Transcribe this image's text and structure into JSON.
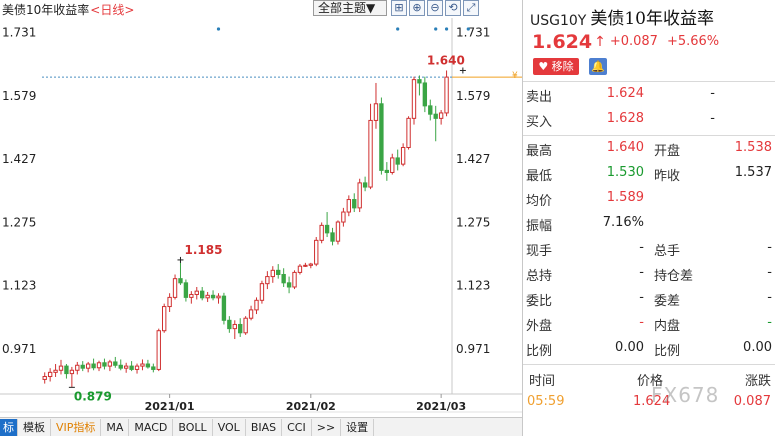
{
  "chart_header": {
    "title": "美债10年收益率",
    "period_label": "<日线>",
    "theme_button": "全部主题▼",
    "tool_icons": [
      "crosshair-icon",
      "zoom-in-icon",
      "zoom-out-icon",
      "reset-icon",
      "fullscreen-icon"
    ],
    "tool_glyphs": [
      "⊞",
      "⊕",
      "⊖",
      "⟲",
      "⤢"
    ]
  },
  "chart_data": {
    "type": "candlestick",
    "title": "美债10年收益率",
    "y_ticks": [
      "1.731",
      "1.579",
      "1.427",
      "1.275",
      "1.123",
      "0.971"
    ],
    "y_tick_values": [
      1.731,
      1.579,
      1.427,
      1.275,
      1.123,
      0.971
    ],
    "ylim": [
      0.863,
      1.766
    ],
    "x_ticks": [
      "2021/01",
      "2021/02",
      "2021/03"
    ],
    "x_tick_indices": [
      23,
      49,
      73
    ],
    "current_price_line": 1.624,
    "annotations": [
      {
        "label": "1.640",
        "index": 77,
        "value": 1.64,
        "type": "high"
      },
      {
        "label": "1.185",
        "index": 25,
        "value": 1.185,
        "type": "high"
      },
      {
        "label": "0.879",
        "index": 5,
        "value": 0.879,
        "type": "low"
      }
    ],
    "event_marker_indices": [
      32,
      65,
      72,
      74,
      78
    ],
    "grid": false,
    "candles": [
      {
        "o": 0.898,
        "h": 0.915,
        "l": 0.888,
        "c": 0.905
      },
      {
        "o": 0.905,
        "h": 0.925,
        "l": 0.893,
        "c": 0.915
      },
      {
        "o": 0.915,
        "h": 0.935,
        "l": 0.904,
        "c": 0.92
      },
      {
        "o": 0.92,
        "h": 0.945,
        "l": 0.91,
        "c": 0.93
      },
      {
        "o": 0.93,
        "h": 0.935,
        "l": 0.9,
        "c": 0.912
      },
      {
        "o": 0.912,
        "h": 0.928,
        "l": 0.879,
        "c": 0.92
      },
      {
        "o": 0.92,
        "h": 0.94,
        "l": 0.91,
        "c": 0.932
      },
      {
        "o": 0.932,
        "h": 0.942,
        "l": 0.918,
        "c": 0.925
      },
      {
        "o": 0.925,
        "h": 0.94,
        "l": 0.915,
        "c": 0.935
      },
      {
        "o": 0.935,
        "h": 0.948,
        "l": 0.92,
        "c": 0.926
      },
      {
        "o": 0.926,
        "h": 0.943,
        "l": 0.918,
        "c": 0.938
      },
      {
        "o": 0.938,
        "h": 0.948,
        "l": 0.922,
        "c": 0.93
      },
      {
        "o": 0.93,
        "h": 0.945,
        "l": 0.918,
        "c": 0.94
      },
      {
        "o": 0.94,
        "h": 0.952,
        "l": 0.926,
        "c": 0.932
      },
      {
        "o": 0.932,
        "h": 0.946,
        "l": 0.92,
        "c": 0.925
      },
      {
        "o": 0.925,
        "h": 0.938,
        "l": 0.914,
        "c": 0.93
      },
      {
        "o": 0.93,
        "h": 0.942,
        "l": 0.918,
        "c": 0.922
      },
      {
        "o": 0.922,
        "h": 0.936,
        "l": 0.912,
        "c": 0.93
      },
      {
        "o": 0.93,
        "h": 0.946,
        "l": 0.92,
        "c": 0.935
      },
      {
        "o": 0.935,
        "h": 0.945,
        "l": 0.924,
        "c": 0.928
      },
      {
        "o": 0.928,
        "h": 0.936,
        "l": 0.915,
        "c": 0.922
      },
      {
        "o": 0.922,
        "h": 1.02,
        "l": 0.918,
        "c": 1.015
      },
      {
        "o": 1.015,
        "h": 1.08,
        "l": 1.01,
        "c": 1.073
      },
      {
        "o": 1.073,
        "h": 1.105,
        "l": 1.06,
        "c": 1.095
      },
      {
        "o": 1.095,
        "h": 1.15,
        "l": 1.09,
        "c": 1.14
      },
      {
        "o": 1.14,
        "h": 1.185,
        "l": 1.125,
        "c": 1.13
      },
      {
        "o": 1.13,
        "h": 1.138,
        "l": 1.085,
        "c": 1.095
      },
      {
        "o": 1.095,
        "h": 1.11,
        "l": 1.08,
        "c": 1.102
      },
      {
        "o": 1.102,
        "h": 1.12,
        "l": 1.09,
        "c": 1.11
      },
      {
        "o": 1.11,
        "h": 1.12,
        "l": 1.088,
        "c": 1.094
      },
      {
        "o": 1.094,
        "h": 1.108,
        "l": 1.084,
        "c": 1.1
      },
      {
        "o": 1.1,
        "h": 1.112,
        "l": 1.088,
        "c": 1.094
      },
      {
        "o": 1.094,
        "h": 1.105,
        "l": 1.08,
        "c": 1.098
      },
      {
        "o": 1.098,
        "h": 1.106,
        "l": 1.03,
        "c": 1.04
      },
      {
        "o": 1.04,
        "h": 1.05,
        "l": 1.01,
        "c": 1.02
      },
      {
        "o": 1.02,
        "h": 1.04,
        "l": 0.995,
        "c": 1.03
      },
      {
        "o": 1.03,
        "h": 1.045,
        "l": 1.0,
        "c": 1.01
      },
      {
        "o": 1.01,
        "h": 1.05,
        "l": 1.005,
        "c": 1.045
      },
      {
        "o": 1.045,
        "h": 1.075,
        "l": 1.04,
        "c": 1.065
      },
      {
        "o": 1.065,
        "h": 1.095,
        "l": 1.055,
        "c": 1.088
      },
      {
        "o": 1.088,
        "h": 1.135,
        "l": 1.08,
        "c": 1.128
      },
      {
        "o": 1.128,
        "h": 1.158,
        "l": 1.115,
        "c": 1.145
      },
      {
        "o": 1.145,
        "h": 1.17,
        "l": 1.13,
        "c": 1.16
      },
      {
        "o": 1.16,
        "h": 1.175,
        "l": 1.14,
        "c": 1.15
      },
      {
        "o": 1.15,
        "h": 1.165,
        "l": 1.12,
        "c": 1.13
      },
      {
        "o": 1.13,
        "h": 1.145,
        "l": 1.105,
        "c": 1.12
      },
      {
        "o": 1.12,
        "h": 1.16,
        "l": 1.115,
        "c": 1.155
      },
      {
        "o": 1.155,
        "h": 1.175,
        "l": 1.15,
        "c": 1.17
      },
      {
        "o": 1.17,
        "h": 1.178,
        "l": 1.168,
        "c": 1.172
      },
      {
        "o": 1.172,
        "h": 1.178,
        "l": 1.165,
        "c": 1.175
      },
      {
        "o": 1.175,
        "h": 1.24,
        "l": 1.17,
        "c": 1.232
      },
      {
        "o": 1.232,
        "h": 1.275,
        "l": 1.225,
        "c": 1.268
      },
      {
        "o": 1.268,
        "h": 1.3,
        "l": 1.24,
        "c": 1.25
      },
      {
        "o": 1.25,
        "h": 1.262,
        "l": 1.22,
        "c": 1.23
      },
      {
        "o": 1.23,
        "h": 1.28,
        "l": 1.222,
        "c": 1.276
      },
      {
        "o": 1.276,
        "h": 1.31,
        "l": 1.265,
        "c": 1.3
      },
      {
        "o": 1.3,
        "h": 1.34,
        "l": 1.29,
        "c": 1.33
      },
      {
        "o": 1.33,
        "h": 1.345,
        "l": 1.3,
        "c": 1.31
      },
      {
        "o": 1.31,
        "h": 1.38,
        "l": 1.3,
        "c": 1.37
      },
      {
        "o": 1.37,
        "h": 1.385,
        "l": 1.35,
        "c": 1.36
      },
      {
        "o": 1.36,
        "h": 1.56,
        "l": 1.355,
        "c": 1.52
      },
      {
        "o": 1.52,
        "h": 1.61,
        "l": 1.5,
        "c": 1.56
      },
      {
        "o": 1.56,
        "h": 1.575,
        "l": 1.39,
        "c": 1.4
      },
      {
        "o": 1.4,
        "h": 1.42,
        "l": 1.375,
        "c": 1.395
      },
      {
        "o": 1.395,
        "h": 1.44,
        "l": 1.39,
        "c": 1.43
      },
      {
        "o": 1.43,
        "h": 1.45,
        "l": 1.4,
        "c": 1.415
      },
      {
        "o": 1.415,
        "h": 1.465,
        "l": 1.41,
        "c": 1.455
      },
      {
        "o": 1.455,
        "h": 1.53,
        "l": 1.45,
        "c": 1.525
      },
      {
        "o": 1.525,
        "h": 1.625,
        "l": 1.51,
        "c": 1.618
      },
      {
        "o": 1.618,
        "h": 1.628,
        "l": 1.58,
        "c": 1.61
      },
      {
        "o": 1.61,
        "h": 1.625,
        "l": 1.54,
        "c": 1.555
      },
      {
        "o": 1.555,
        "h": 1.57,
        "l": 1.52,
        "c": 1.535
      },
      {
        "o": 1.535,
        "h": 1.555,
        "l": 1.47,
        "c": 1.525
      },
      {
        "o": 1.525,
        "h": 1.545,
        "l": 1.51,
        "c": 1.538
      },
      {
        "o": 1.538,
        "h": 1.64,
        "l": 1.53,
        "c": 1.624
      }
    ]
  },
  "bottom_toolbar": {
    "tabs": [
      "标",
      "模板",
      "VIP指标",
      "MA",
      "MACD",
      "BOLL",
      "VOL",
      "BIAS",
      "CCI",
      ">>",
      "设置"
    ]
  },
  "quote": {
    "code": "USG10Y",
    "name": "美债10年收益率",
    "price": "1.624",
    "change": "+0.087",
    "change_pct": "+5.66%",
    "remove_label": "移除",
    "alert_icon": "bell-icon",
    "colors": {
      "up": "#e4393c",
      "down": "#1a9a2f",
      "accent": "#1e6fc8"
    },
    "rows_single": [
      {
        "label": "卖出",
        "value": "1.624",
        "extra": "-",
        "color": "red"
      },
      {
        "label": "买入",
        "value": "1.628",
        "extra": "-",
        "color": "red"
      }
    ],
    "rows_pair": [
      {
        "label1": "最高",
        "value1": "1.640",
        "c1": "red",
        "label2": "开盘",
        "value2": "1.538",
        "c2": "red"
      },
      {
        "label1": "最低",
        "value1": "1.530",
        "c1": "green",
        "label2": "昨收",
        "value2": "1.537",
        "c2": "black"
      },
      {
        "label1": "均价",
        "value1": "1.589",
        "c1": "red",
        "label2": "",
        "value2": "",
        "c2": "black"
      },
      {
        "label1": "振幅",
        "value1": "7.16%",
        "c1": "black",
        "label2": "",
        "value2": "",
        "c2": "black"
      },
      {
        "label1": "现手",
        "value1": "-",
        "c1": "black",
        "label2": "总手",
        "value2": "-",
        "c2": "black"
      },
      {
        "label1": "总持",
        "value1": "-",
        "c1": "black",
        "label2": "持仓差",
        "value2": "-",
        "c2": "black"
      },
      {
        "label1": "委比",
        "value1": "-",
        "c1": "black",
        "label2": "委差",
        "value2": "-",
        "c2": "black"
      },
      {
        "label1": "外盘",
        "value1": "-",
        "c1": "red",
        "label2": "内盘",
        "value2": "-",
        "c2": "green"
      },
      {
        "label1": "比例",
        "value1": "0.00",
        "c1": "black",
        "label2": "比例",
        "value2": "0.00",
        "c2": "black"
      }
    ],
    "trades_header": {
      "time": "时间",
      "price": "价格",
      "change": "涨跌"
    },
    "trades": [
      {
        "time": "05:59",
        "price": "1.624",
        "change": "0.087"
      }
    ],
    "watermark": "FX678"
  }
}
